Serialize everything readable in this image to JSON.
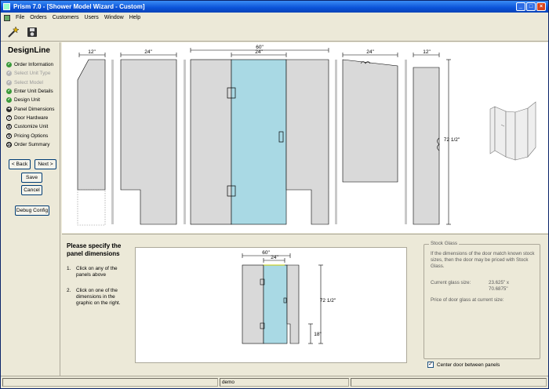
{
  "window": {
    "title": "Prism 7.0 - [Shower Model Wizard - Custom]",
    "controls": {
      "minimize": "_",
      "maximize": "□",
      "close": "×"
    }
  },
  "menu": {
    "items": [
      "File",
      "Orders",
      "Customers",
      "Users",
      "Window",
      "Help"
    ]
  },
  "toolbar": {
    "tools": [
      "wizard-wand-icon",
      "disk-icon"
    ]
  },
  "sidebar": {
    "title": "DesignLine",
    "steps": [
      {
        "num": "1",
        "label": "Order Information",
        "state": "done"
      },
      {
        "num": "2",
        "label": "Select Unit Type",
        "state": "disabled"
      },
      {
        "num": "3",
        "label": "Select Model",
        "state": "disabled"
      },
      {
        "num": "4",
        "label": "Enter Unit Details",
        "state": "done"
      },
      {
        "num": "5",
        "label": "Design Unit",
        "state": "done"
      },
      {
        "num": "6",
        "label": "Panel Dimensions",
        "state": "current"
      },
      {
        "num": "7",
        "label": "Door Hardware",
        "state": "pending"
      },
      {
        "num": "8",
        "label": "Customize Unit",
        "state": "pending"
      },
      {
        "num": "9",
        "label": "Pricing Options",
        "state": "pending"
      },
      {
        "num": "10",
        "label": "Order Summary",
        "state": "pending"
      }
    ],
    "back_label": "< Back",
    "next_label": "Next >",
    "save_label": "Save",
    "cancel_label": "Cancel",
    "debug_label": "Debug Config"
  },
  "canvas": {
    "dims": {
      "p1": "12\"",
      "p2": "24\"",
      "total": "60\"",
      "door": "24\"",
      "p5": "24\"",
      "p6": "12\"",
      "height": "72 1/2\""
    }
  },
  "instructions": {
    "title": "Please specify the panel dimensions",
    "steps": [
      {
        "num": "1.",
        "text": "Click on any of the panels above"
      },
      {
        "num": "2.",
        "text": "Click on one of the dimensions in the graphic on the right."
      }
    ]
  },
  "preview": {
    "dims": {
      "total": "60\"",
      "door": "24\"",
      "height": "72 1/2\"",
      "notch": "18\""
    }
  },
  "stock_glass": {
    "legend": "Stock Glass",
    "description": "If the dimensions of the door match known stock sizes, then the door may be priced with Stock Glass.",
    "current_label": "Current glass size:",
    "current_w": "23.625\" x",
    "current_h": "70.6875\"",
    "price_label": "Price of door glass at current size:"
  },
  "center_door": {
    "label": "Center door between panels",
    "checked": true
  },
  "status": {
    "pane1": "",
    "pane2": "demo",
    "pane3": ""
  },
  "colors": {
    "panel": "#d9d9d9",
    "door_glass": "#a9d9e4",
    "title_bar": "#0a52d8"
  }
}
